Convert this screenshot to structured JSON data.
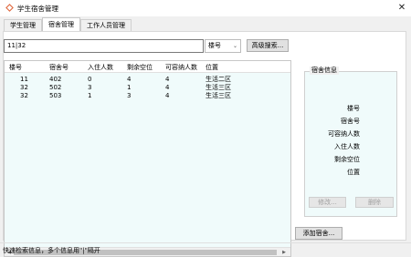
{
  "window": {
    "title": "学生宿舍管理"
  },
  "tabs": [
    {
      "label": "学生管理"
    },
    {
      "label": "宿舍管理"
    },
    {
      "label": "工作人员管理"
    }
  ],
  "search": {
    "value": "11|32",
    "field": "楼号",
    "advanced_label": "高级搜索..."
  },
  "table": {
    "headers": [
      "楼号",
      "宿舍号",
      "入住人数",
      "剩余空位",
      "可容纳人数",
      "位置"
    ],
    "rows": [
      [
        "11",
        "402",
        "0",
        "4",
        "4",
        "生活二区"
      ],
      [
        "32",
        "502",
        "3",
        "1",
        "4",
        "生活三区"
      ],
      [
        "32",
        "503",
        "1",
        "3",
        "4",
        "生活三区"
      ]
    ]
  },
  "info": {
    "title": "宿舍信息",
    "labels": [
      "楼号",
      "宿舍号",
      "可容纳人数",
      "入住人数",
      "剩余空位",
      "位置"
    ],
    "edit_label": "修改...",
    "delete_label": "删除"
  },
  "add_label": "添加宿舍...",
  "status_text": "快速检索信息，多个信息用\"|\"隔开"
}
